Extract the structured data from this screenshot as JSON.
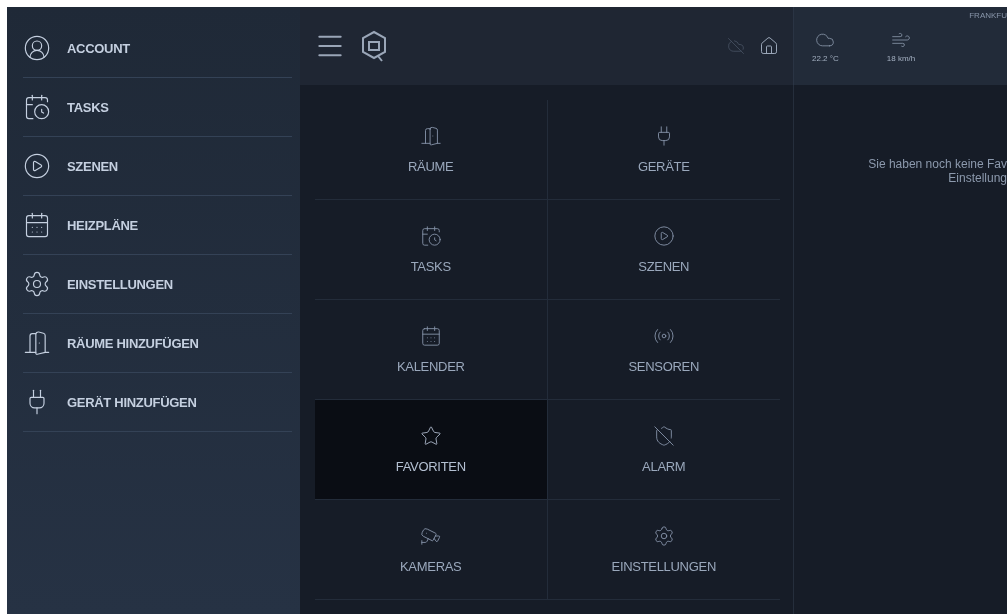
{
  "sidebar": {
    "items": [
      {
        "kind": "account",
        "label": "ACCOUNT"
      },
      {
        "kind": "tasks",
        "label": "TASKS"
      },
      {
        "kind": "scenes",
        "label": "SZENEN"
      },
      {
        "kind": "heating",
        "label": "HEIZPLÄNE"
      },
      {
        "kind": "settings",
        "label": "EINSTELLUNGEN"
      },
      {
        "kind": "add-room",
        "label": "RÄUME HINZUFÜGEN"
      },
      {
        "kind": "add-device",
        "label": "GERÄT HINZUFÜGEN"
      }
    ]
  },
  "weather": {
    "city": "FRANKFU",
    "temperature": "22.2 °C",
    "wind": "18 km/h"
  },
  "tiles": [
    {
      "kind": "rooms",
      "label": "RÄUME",
      "selected": false
    },
    {
      "kind": "devices",
      "label": "GERÄTE",
      "selected": false
    },
    {
      "kind": "tasks",
      "label": "TASKS",
      "selected": false
    },
    {
      "kind": "scenes",
      "label": "SZENEN",
      "selected": false
    },
    {
      "kind": "calendar",
      "label": "KALENDER",
      "selected": false
    },
    {
      "kind": "sensors",
      "label": "SENSOREN",
      "selected": false
    },
    {
      "kind": "favorites",
      "label": "FAVORITEN",
      "selected": true
    },
    {
      "kind": "alarm",
      "label": "ALARM",
      "selected": false
    },
    {
      "kind": "cameras",
      "label": "KAMERAS",
      "selected": false
    },
    {
      "kind": "settings",
      "label": "EINSTELLUNGEN",
      "selected": false
    }
  ],
  "favorites_message": [
    "Sie haben noch keine Fav",
    "Einstellung"
  ]
}
